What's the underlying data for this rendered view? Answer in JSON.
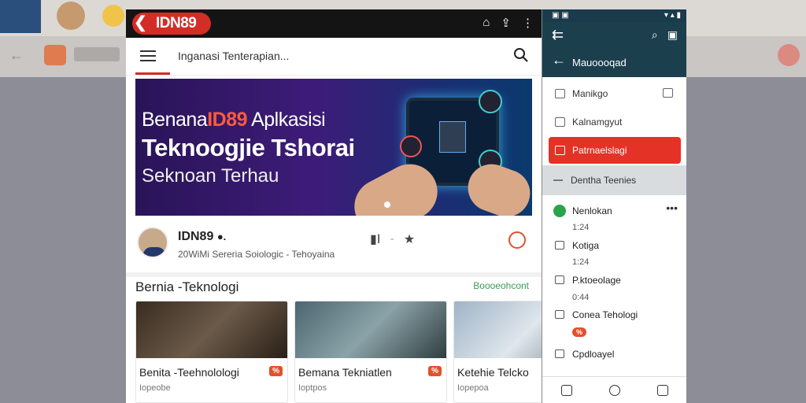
{
  "app": {
    "brand": "IDN89",
    "search_text": "Inganasi Tenterapian..."
  },
  "banner": {
    "line1_pre": "Benana",
    "line1_accent": "ID89",
    "line1_post": " Aplkasisi",
    "line2": "Teknoogjie Tshorai",
    "line3": "Seknoan Terhau"
  },
  "author": {
    "name": "IDN89",
    "meta": "20WiMi Sereria Soiologic  -  Tehoyaina"
  },
  "section": {
    "title": "Bernia -Teknologi",
    "link": "Boooeohcont"
  },
  "cards": [
    {
      "title": "Benita -Teehnolologi",
      "sub": "Iopeobe",
      "badge": "%"
    },
    {
      "title": "Bemana Tekniatlen",
      "sub": "Ioptpos",
      "badge": "%"
    },
    {
      "title": "Ketehie Telcko",
      "sub": "Iopepoa",
      "badge": ""
    }
  ],
  "panel": {
    "status_left": "▣ ▣",
    "status_right": "▾ ▴ ▮",
    "title": "Mauoooqad",
    "menu": [
      {
        "label": "Manikgo"
      },
      {
        "label": "Kalnamgyut"
      },
      {
        "label": "Patrnaelslagi"
      },
      {
        "label": "Dentha Teenies"
      }
    ],
    "items": [
      {
        "name": "Nenlokan",
        "meta": "1:24"
      },
      {
        "name": "Kotiga",
        "meta": "1:24"
      },
      {
        "name": "P.ktoeolage",
        "meta": "0:44"
      },
      {
        "name": "Conea Tehologi",
        "meta": "%"
      },
      {
        "name": "Cpdloayel",
        "meta": ""
      }
    ]
  }
}
